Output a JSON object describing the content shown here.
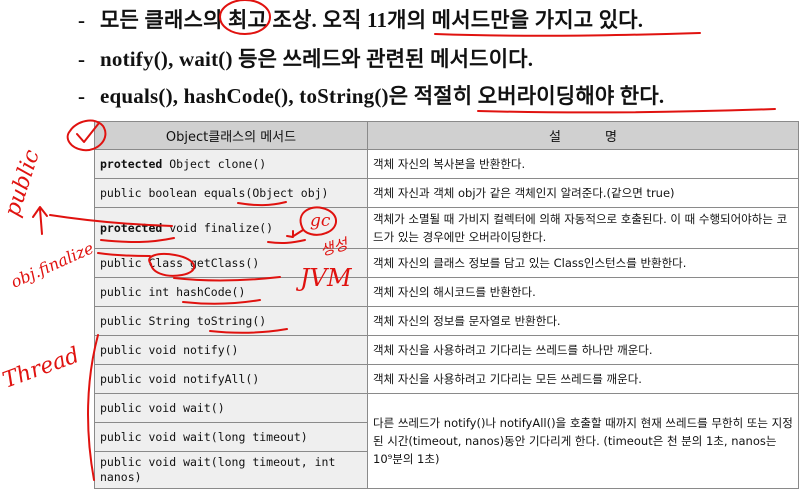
{
  "bullets": [
    {
      "dash": "-",
      "text": "모든 클래스의 최고 조상. 오직 11개의 메서드만을 가지고 있다."
    },
    {
      "dash": "-",
      "text": "notify(), wait() 등은 쓰레드와 관련된 메서드이다."
    },
    {
      "dash": "-",
      "text": "equals(), hashCode(), toString()은 적절히 오버라이딩해야 한다."
    }
  ],
  "table": {
    "headers": {
      "method": "Object클래스의 메서드",
      "description": "설명"
    },
    "rows": [
      {
        "kw": "protected",
        "sig": " Object clone()",
        "desc": "객체 자신의 복사본을 반환한다."
      },
      {
        "kw": "",
        "sig": "public boolean equals(Object obj)",
        "desc": "객체 자신과 객체 obj가 같은 객체인지 알려준다.(같으면 true)"
      },
      {
        "kw": "protected",
        "sig": " void finalize()",
        "desc": "객체가 소멸될 때 가비지 컬렉터에 의해 자동적으로 호출된다. 이 때 수행되어야하는 코드가 있는 경우에만 오버라이딩한다."
      },
      {
        "kw": "",
        "sig": "public Class getClass()",
        "desc": "객체 자신의 클래스 정보를 담고 있는 Class인스턴스를 반환한다."
      },
      {
        "kw": "",
        "sig": "public int hashCode()",
        "desc": "객체 자신의 해시코드를 반환한다."
      },
      {
        "kw": "",
        "sig": "public String toString()",
        "desc": "객체 자신의 정보를 문자열로 반환한다."
      },
      {
        "kw": "",
        "sig": "public void notify()",
        "desc": "객체 자신을 사용하려고 기다리는 쓰레드를 하나만 깨운다."
      },
      {
        "kw": "",
        "sig": "public void notifyAll()",
        "desc": "객체 자신을 사용하려고 기다리는 모든 쓰레드를 깨운다."
      }
    ],
    "wait_rows": [
      "public void wait()",
      "public void wait(long timeout)",
      "public void wait(long timeout, int nanos)"
    ],
    "wait_desc": "다른 쓰레드가 notify()나 notifyAll()을 호출할 때까지 현재 쓰레드를 무한히 또는 지정된 시간(timeout, nanos)동안 기다리게 한다. (timeout은 천 분의 1초, nanos는 10⁹분의 1초)"
  },
  "handwriting": {
    "public": "public",
    "obj_finalize": "obj.finalize",
    "gc": "gc",
    "saengseong": "생성",
    "jvm": "JVM",
    "thread": "Thread"
  },
  "colors": {
    "ink": "#e0120f",
    "header_bg": "#d0d0d0",
    "row_bg": "#efefef"
  }
}
